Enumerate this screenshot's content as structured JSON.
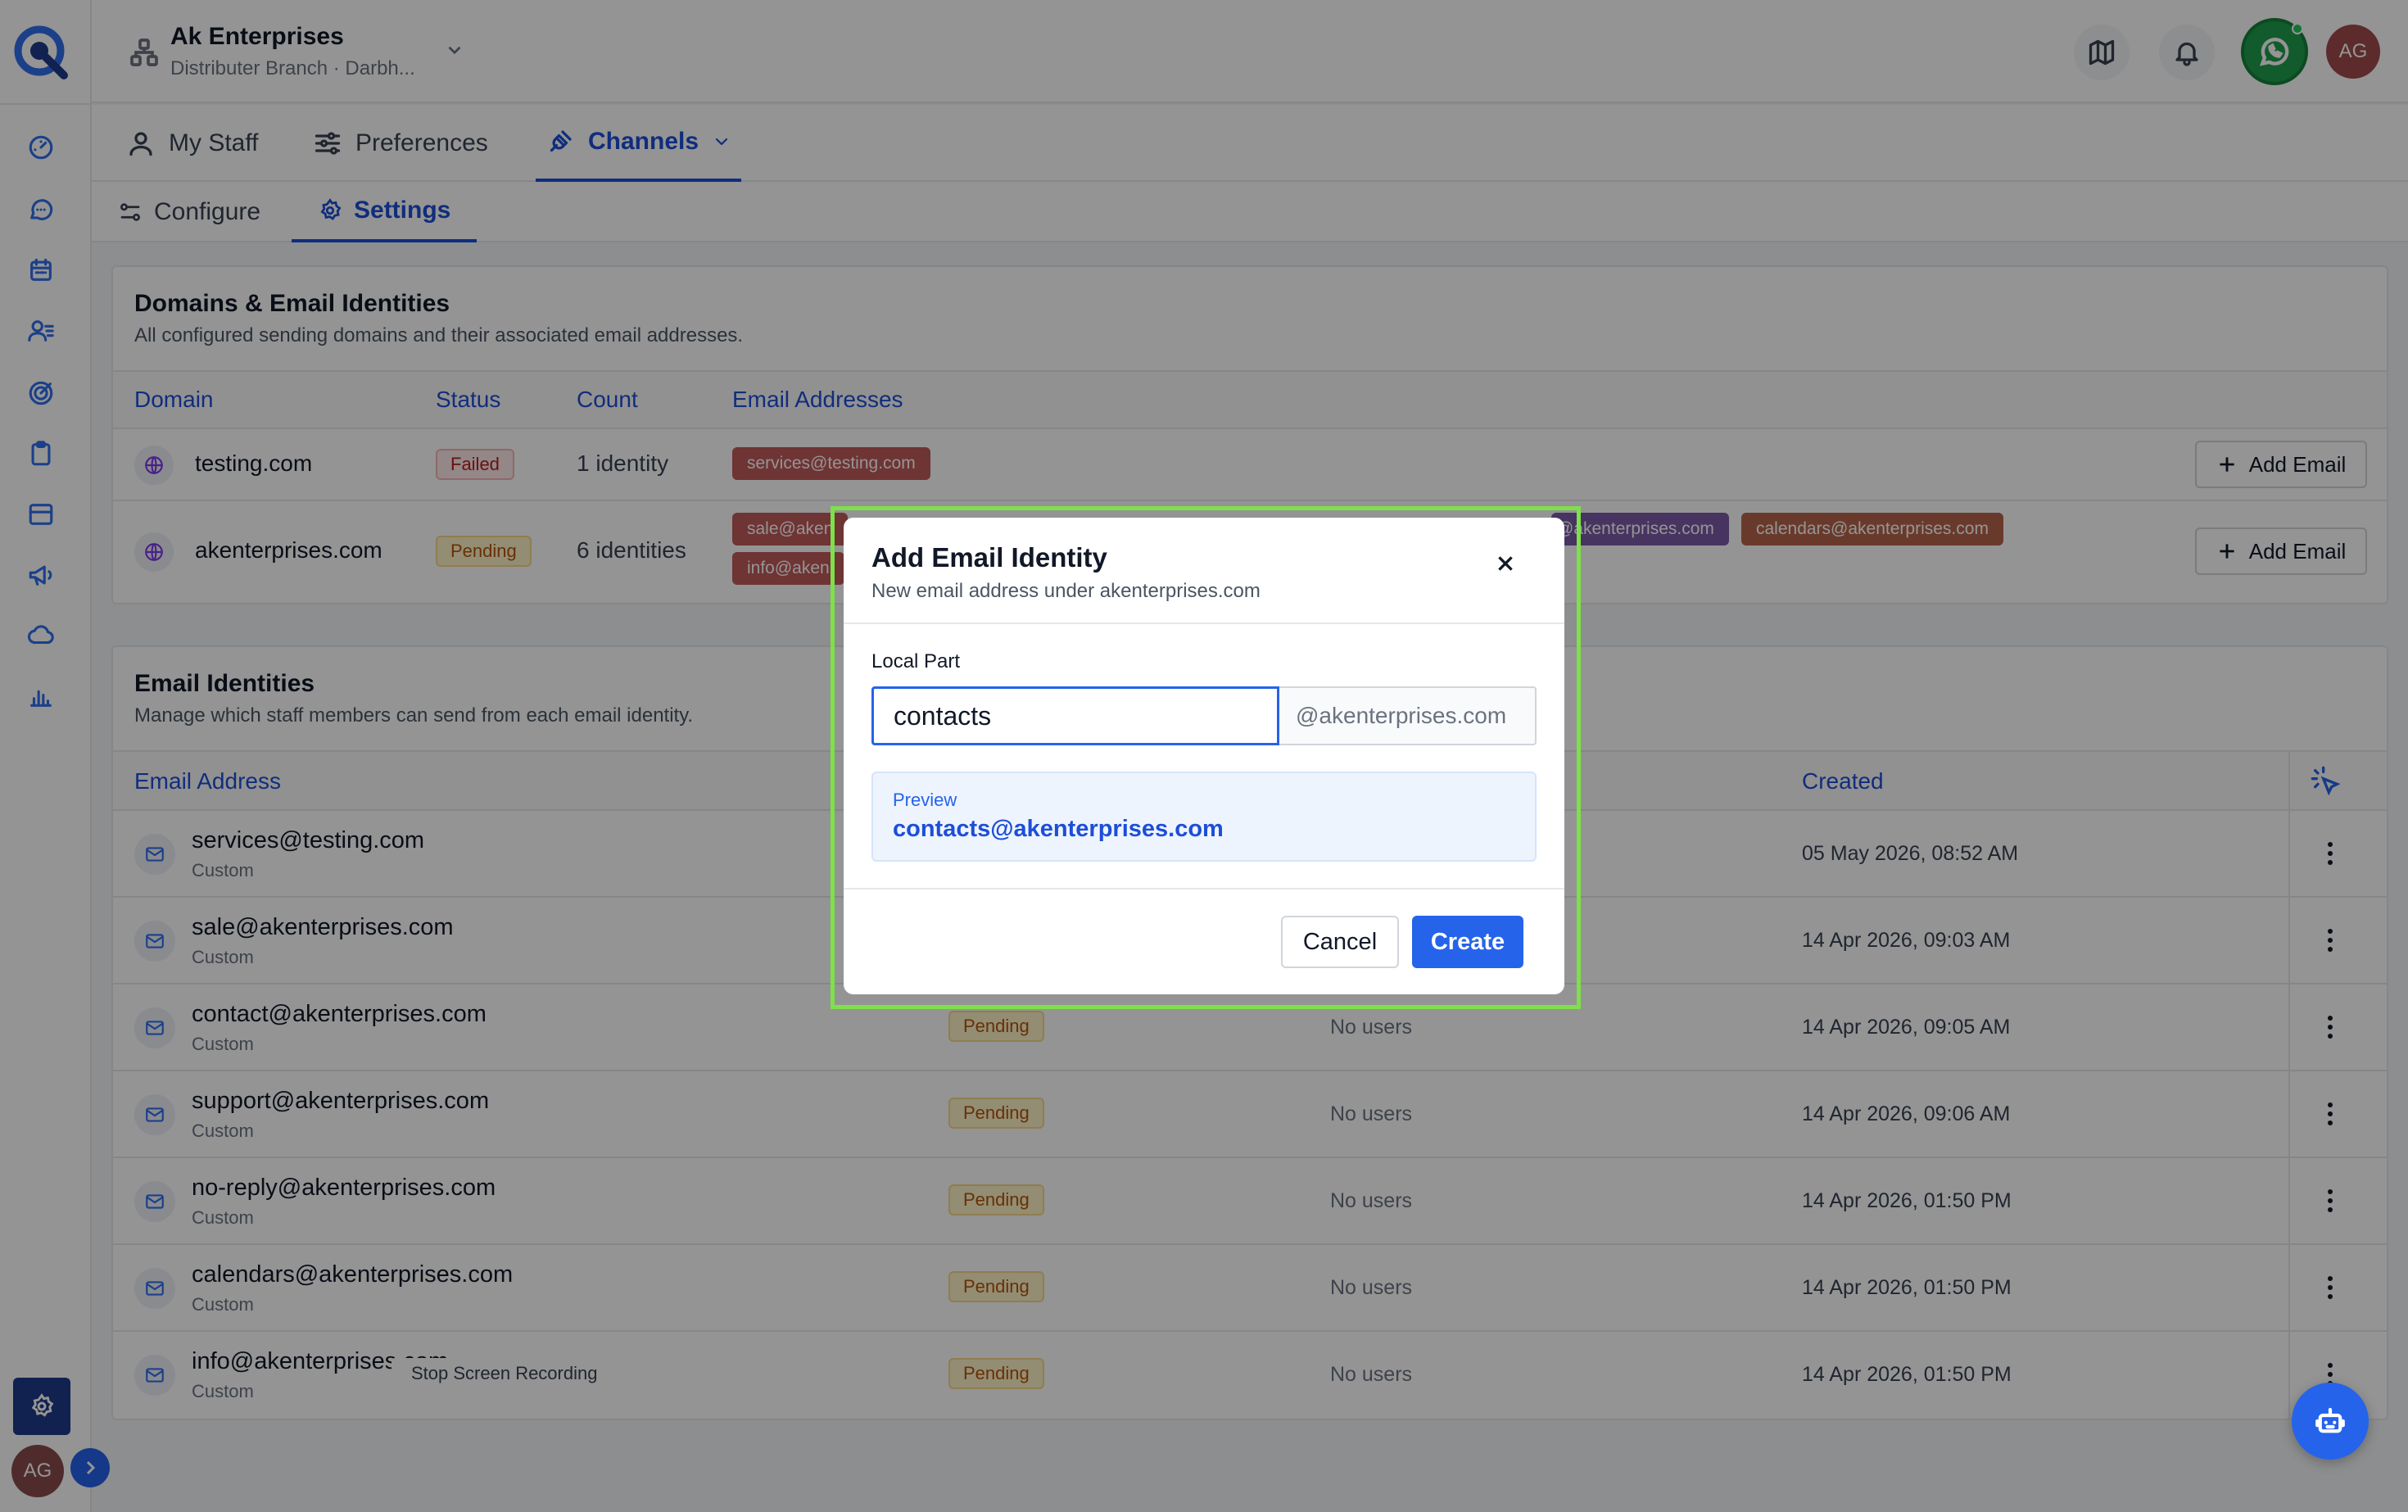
{
  "header": {
    "org_name": "Ak Enterprises",
    "org_sub": "Distributer Branch · Darbh...",
    "avatar": "AG",
    "icons": [
      "map-icon",
      "bell-icon",
      "whatsapp-icon"
    ]
  },
  "tabs": [
    {
      "label": "My Staff",
      "icon": "user-icon"
    },
    {
      "label": "Preferences",
      "icon": "sliders-icon"
    },
    {
      "label": "Channels",
      "icon": "plug-icon",
      "active": true
    }
  ],
  "subtabs": [
    {
      "label": "Configure",
      "icon": "toggles-icon"
    },
    {
      "label": "Settings",
      "icon": "gear-icon",
      "active": true
    }
  ],
  "domains": {
    "title": "Domains & Email Identities",
    "subtitle": "All configured sending domains and their associated email addresses.",
    "columns": [
      "Domain",
      "Status",
      "Count",
      "Email Addresses"
    ],
    "add_label": "Add Email",
    "rows": [
      {
        "domain": "testing.com",
        "status": "Failed",
        "count": "1 identity",
        "chips": [
          "services@testing.com"
        ]
      },
      {
        "domain": "akenterprises.com",
        "status": "Pending",
        "count": "6 identities",
        "chips": [
          "sale@aken",
          "info@aken",
          "@akenterprises.com",
          "calendars@akenterprises.com"
        ]
      }
    ]
  },
  "identities": {
    "title": "Email Identities",
    "subtitle": "Manage which staff members can send from each email identity.",
    "col_email": "Email Address",
    "col_created": "Created",
    "rows": [
      {
        "email": "services@testing.com",
        "type": "Custom",
        "status": "",
        "users": "",
        "created": "05 May 2026, 08:52 AM"
      },
      {
        "email": "sale@akenterprises.com",
        "type": "Custom",
        "status": "",
        "users": "",
        "created": "14 Apr 2026, 09:03 AM"
      },
      {
        "email": "contact@akenterprises.com",
        "type": "Custom",
        "status": "Pending",
        "users": "No users",
        "created": "14 Apr 2026, 09:05 AM"
      },
      {
        "email": "support@akenterprises.com",
        "type": "Custom",
        "status": "Pending",
        "users": "No users",
        "created": "14 Apr 2026, 09:06 AM"
      },
      {
        "email": "no-reply@akenterprises.com",
        "type": "Custom",
        "status": "Pending",
        "users": "No users",
        "created": "14 Apr 2026, 01:50 PM"
      },
      {
        "email": "calendars@akenterprises.com",
        "type": "Custom",
        "status": "Pending",
        "users": "No users",
        "created": "14 Apr 2026, 01:50 PM"
      },
      {
        "email": "info@akenterprises.com",
        "type": "Custom",
        "status": "Pending",
        "users": "No users",
        "created": "14 Apr 2026, 01:50 PM"
      }
    ]
  },
  "modal": {
    "title": "Add Email Identity",
    "subtitle": "New email address under akenterprises.com",
    "field_label": "Local Part",
    "input_value": "contacts",
    "suffix": "@akenterprises.com",
    "preview_label": "Preview",
    "preview_value": "contacts@akenterprises.com",
    "cancel": "Cancel",
    "create": "Create"
  },
  "recording_tip": "Stop Screen Recording",
  "colors": {
    "accent": "#2563eb",
    "chip_failed": "#c05a5a",
    "chip_purple": "#7a5aa8",
    "chip_brown": "#b5644a",
    "focus_ring": "#7ee04a"
  }
}
